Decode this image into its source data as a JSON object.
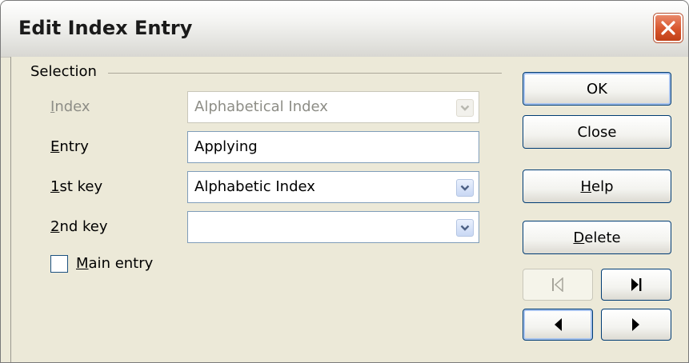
{
  "window": {
    "title": "Edit Index Entry",
    "close_icon": "close-x-icon"
  },
  "selection": {
    "group_label": "Selection",
    "index": {
      "label": "Index",
      "value": "Alphabetical Index",
      "enabled": false
    },
    "entry": {
      "label": "Entry",
      "value": "Applying"
    },
    "key1": {
      "label": "1st key",
      "value": "Alphabetic Index"
    },
    "key2": {
      "label": "2nd key",
      "value": ""
    },
    "main_entry": {
      "label": "Main entry",
      "checked": false
    }
  },
  "buttons": {
    "ok": "OK",
    "close": "Close",
    "help": "Help",
    "delete": "Delete"
  },
  "navigation": {
    "first_icon": "skip-to-first-icon",
    "last_icon": "skip-to-last-icon",
    "previous_icon": "previous-arrow-icon",
    "next_icon": "next-arrow-icon",
    "first_enabled": false
  },
  "colors": {
    "dialog_bg": "#ece9d8",
    "close_button": "#d8552c",
    "button_border": "#003c74",
    "field_border": "#7f9db9"
  }
}
